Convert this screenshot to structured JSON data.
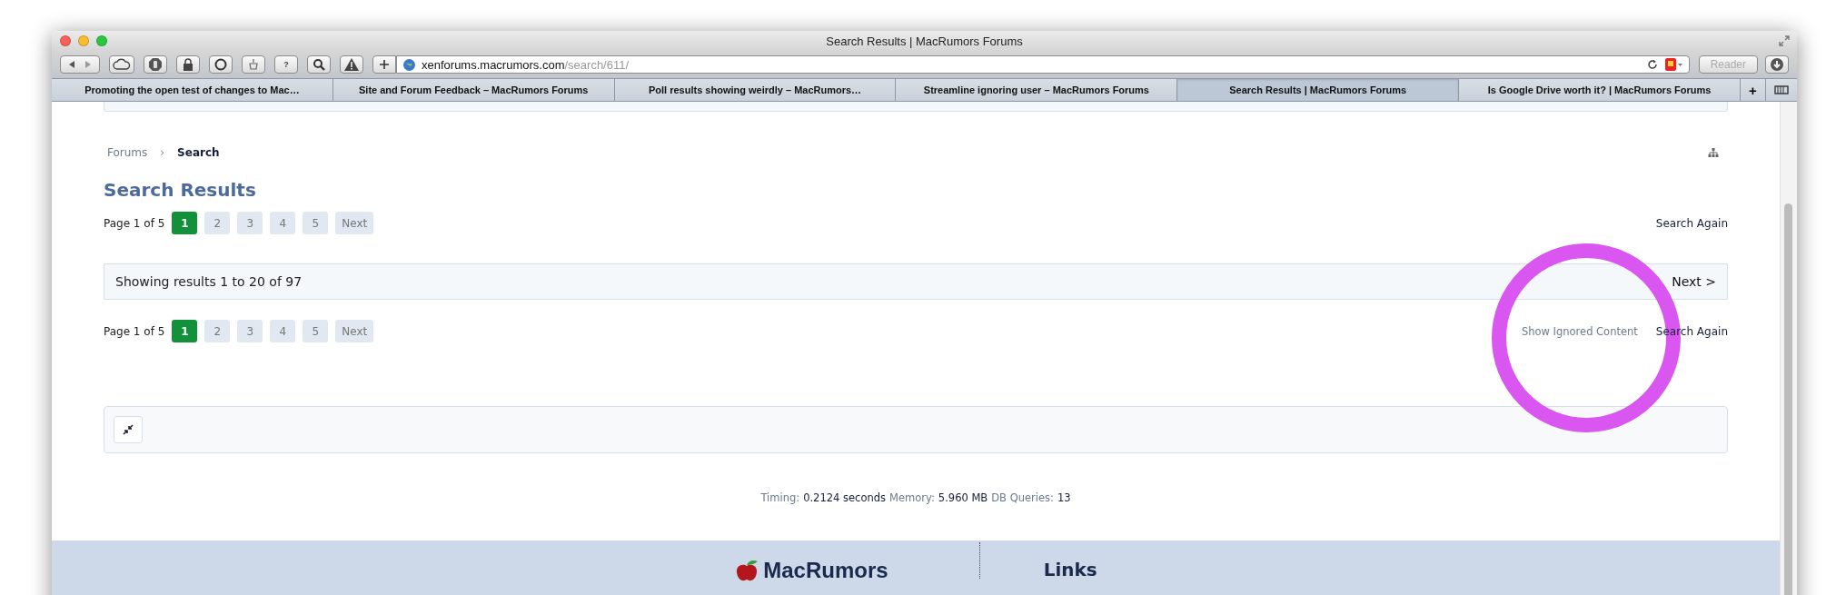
{
  "window": {
    "title": "Search Results | MacRumors Forums"
  },
  "toolbar": {
    "help_label": "?"
  },
  "address_bar": {
    "host": "xenforums.macrumors.com",
    "path": "/search/611/"
  },
  "reader_button": {
    "label": "Reader",
    "disabled": true
  },
  "tabs": [
    {
      "label": "Promoting the open test of changes to Mac…",
      "selected": false
    },
    {
      "label": "Site and Forum Feedback – MacRumors Forums",
      "selected": false
    },
    {
      "label": "Poll results showing weirdly – MacRumors…",
      "selected": false
    },
    {
      "label": "Streamline ignoring user – MacRumors Forums",
      "selected": false
    },
    {
      "label": "Search Results | MacRumors Forums",
      "selected": true
    },
    {
      "label": "Is Google Drive worth it? | MacRumors Forums",
      "selected": false
    }
  ],
  "new_tab_label": "+",
  "breadcrumb": [
    {
      "label": "Forums",
      "current": false
    },
    {
      "label": "Search",
      "current": true
    }
  ],
  "breadcrumb_separator": "›",
  "page_title": "Search Results",
  "pagination_top": {
    "summary": "Page 1 of 5",
    "pages": [
      {
        "label": "1",
        "selected": true
      },
      {
        "label": "2",
        "selected": false
      },
      {
        "label": "3",
        "selected": false
      },
      {
        "label": "4",
        "selected": false
      },
      {
        "label": "5",
        "selected": false
      }
    ],
    "next": "Next",
    "links": [
      "Search Again"
    ]
  },
  "results_bar": {
    "text": "Showing results 1 to 20 of 97",
    "next": "Next >"
  },
  "pagination_bottom": {
    "summary": "Page 1 of 5",
    "pages": [
      {
        "label": "1",
        "selected": true
      },
      {
        "label": "2",
        "selected": false
      },
      {
        "label": "3",
        "selected": false
      },
      {
        "label": "4",
        "selected": false
      },
      {
        "label": "5",
        "selected": false
      }
    ],
    "next": "Next",
    "links": [
      "Show Ignored Content",
      "Search Again"
    ]
  },
  "debug": [
    {
      "label": "Timing:",
      "value": "0.2124 seconds"
    },
    {
      "label": "Memory:",
      "value": "5.960 MB"
    },
    {
      "label": "DB Queries:",
      "value": "13"
    }
  ],
  "footer": {
    "logo": "MacRumors",
    "heading": "Links"
  }
}
